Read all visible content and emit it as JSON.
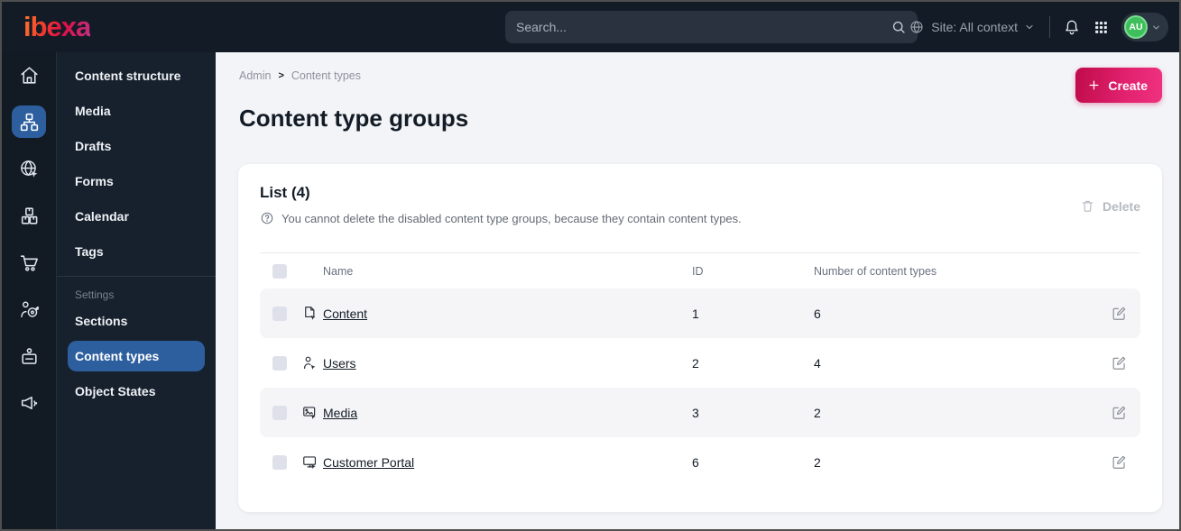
{
  "topbar": {
    "logo_text": "ibexa",
    "search_placeholder": "Search...",
    "site_context_label": "Site: All context",
    "avatar_initials": "AU",
    "icons": [
      "search-icon",
      "globe-icon",
      "chevron-down-icon",
      "bell-icon",
      "app-grid-icon"
    ]
  },
  "icon_rail": {
    "items": [
      "home",
      "content-structure",
      "site",
      "commerce",
      "cart",
      "personalization",
      "corporate-account",
      "campaign"
    ],
    "active_item": "content-structure"
  },
  "sidebar": {
    "items": [
      "Content structure",
      "Media",
      "Drafts",
      "Forms",
      "Calendar",
      "Tags"
    ],
    "settings_section": {
      "label": "Settings",
      "items": [
        "Sections",
        "Content types",
        "Object States"
      ],
      "active_item": "Content types"
    }
  },
  "main": {
    "breadcrumb": {
      "items": [
        "Admin",
        "Content types"
      ],
      "separator": ">"
    },
    "create_button_label": "Create",
    "page_title": "Content type groups",
    "panel": {
      "list_heading": "List (4)",
      "info_text": "You cannot delete the disabled content type groups, because they contain content types.",
      "delete_button_label": "Delete",
      "table": {
        "columns": [
          "Name",
          "ID",
          "Number of content types"
        ],
        "rows": [
          {
            "icon": "file-icon",
            "name": "Content",
            "id": "1",
            "content_types_count": "6"
          },
          {
            "icon": "user-icon",
            "name": "Users",
            "id": "2",
            "content_types_count": "4"
          },
          {
            "icon": "image-icon",
            "name": "Media",
            "id": "3",
            "content_types_count": "2"
          },
          {
            "icon": "monitor-icon",
            "name": "Customer Portal",
            "id": "6",
            "content_types_count": "2"
          }
        ]
      }
    }
  },
  "colors": {
    "topbar_bg": "#131c26",
    "rail_bg": "#121a24",
    "menu_bg": "#17212d",
    "active_blue": "#2d5f9f",
    "create_gradient_start": "#bf0c49",
    "create_gradient_end": "#ef3280",
    "logo_gradient_start": "#ff7a2f",
    "logo_gradient_end": "#c03383",
    "avatar_green": "#3fbf5b",
    "main_bg": "#f3f4f7",
    "row_alt_bg": "#f5f5f8"
  }
}
